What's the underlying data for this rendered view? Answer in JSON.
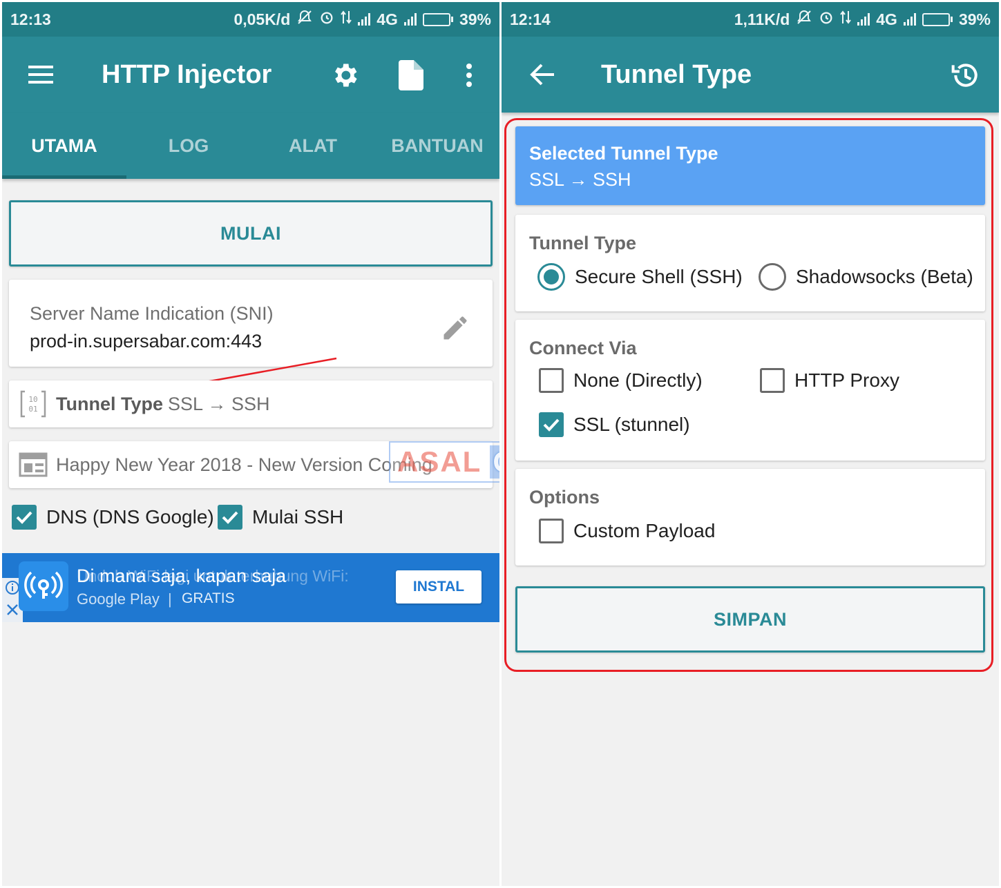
{
  "left_screen": {
    "status": {
      "time": "12:13",
      "speed": "0,05K/d",
      "network": "4G",
      "battery": "39%",
      "battery_level": 0.39
    },
    "appbar": {
      "title": "HTTP Injector",
      "menu_icon": "menu-icon",
      "settings_icon": "gear-icon",
      "config_icon": "document-icon",
      "more_icon": "more-vert-icon"
    },
    "tabs": [
      {
        "label": "UTAMA",
        "active": true
      },
      {
        "label": "LOG",
        "active": false
      },
      {
        "label": "ALAT",
        "active": false
      },
      {
        "label": "BANTUAN",
        "active": false
      }
    ],
    "start_button": "MULAI",
    "sni": {
      "label": "Server Name Indication (SNI)",
      "value": "prod-in.supersabar.com:443",
      "edit_icon": "pencil-icon"
    },
    "tunnel": {
      "label": "Tunnel Type",
      "value": "SSL → SSH",
      "icon": "binary-icon"
    },
    "notice": {
      "text": "Happy New Year 2018 - New Version Coming",
      "icon": "news-icon"
    },
    "checks": [
      {
        "label": "DNS (DNS Google)",
        "checked": true
      },
      {
        "label": "Mulai SSH",
        "checked": true
      }
    ],
    "ad": {
      "headline": "Di mana saja, kapan saja",
      "ghost_text": "Unduh WiFi lagi untuk terhubung WiFi:",
      "store": "Google Play",
      "separator": "|",
      "price": "GRATIS",
      "install": "INSTAL",
      "info_icon": "info-icon",
      "close_icon": "close-icon",
      "logo_icon": "wifi-key-icon"
    },
    "watermark": {
      "part1": "ASAL",
      "part2": "OYEG"
    }
  },
  "right_screen": {
    "status": {
      "time": "12:14",
      "speed": "1,11K/d",
      "network": "4G",
      "battery": "39%",
      "battery_level": 0.39
    },
    "appbar": {
      "title": "Tunnel Type",
      "back_icon": "arrow-back-icon",
      "history_icon": "history-icon"
    },
    "selected": {
      "title": "Selected Tunnel Type",
      "value": "SSL → SSH"
    },
    "tunnel_type": {
      "title": "Tunnel Type",
      "options": [
        {
          "label": "Secure Shell (SSH)",
          "selected": true
        },
        {
          "label": "Shadowsocks (Beta)",
          "selected": false
        }
      ]
    },
    "connect_via": {
      "title": "Connect Via",
      "options": [
        {
          "label": "None (Directly)",
          "checked": false
        },
        {
          "label": "HTTP Proxy",
          "checked": false
        },
        {
          "label": "SSL (stunnel)",
          "checked": true
        }
      ]
    },
    "options": {
      "title": "Options",
      "items": [
        {
          "label": "Custom Payload",
          "checked": false
        }
      ]
    },
    "save_button": "SIMPAN"
  },
  "colors": {
    "primary": "#2a8a96",
    "status_bar": "#227d86",
    "selected_card": "#5aa2f3",
    "annotation_red": "#e81e25",
    "ad_blue": "#1f78d1"
  }
}
